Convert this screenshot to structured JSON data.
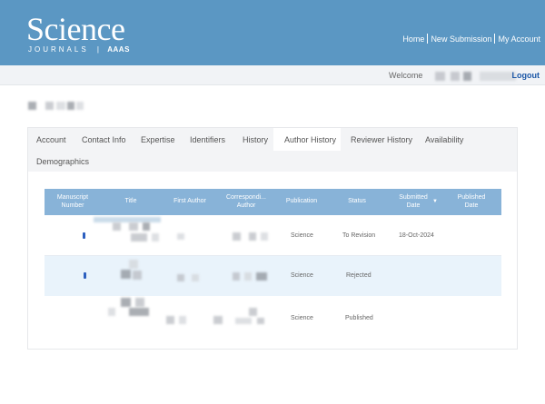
{
  "header": {
    "logo_title": "Science",
    "logo_subtitle": "JOURNALS",
    "logo_org": "AAAS",
    "nav": [
      {
        "label": "Home"
      },
      {
        "label": "New Submission"
      },
      {
        "label": "My Account"
      }
    ]
  },
  "welcome_bar": {
    "welcome_label": "Welcome",
    "logout_label": "Logout"
  },
  "tabs": [
    {
      "label": "Account"
    },
    {
      "label": "Contact Info"
    },
    {
      "label": "Expertise"
    },
    {
      "label": "Identifiers"
    },
    {
      "label": "History"
    },
    {
      "label": "Author History",
      "active": true
    },
    {
      "label": "Reviewer History"
    },
    {
      "label": "Availability"
    },
    {
      "label": "Demographics"
    }
  ],
  "table": {
    "columns": [
      "Manuscript Number",
      "Title",
      "First Author",
      "Correspondi... Author",
      "Publication",
      "Status",
      "Submitted Date",
      "Published Date"
    ],
    "rows": [
      {
        "publication": "Science",
        "status": "To Revision",
        "submitted": "18-Oct-2024",
        "published": ""
      },
      {
        "publication": "Science",
        "status": "Rejected",
        "submitted": "",
        "published": ""
      },
      {
        "publication": "Science",
        "status": "Published",
        "submitted": "",
        "published": ""
      }
    ]
  },
  "colors": {
    "header_bg": "#5b97c3",
    "table_header_bg": "#88b3d8",
    "link": "#1a56a6"
  },
  "icons": {
    "sort": "sort-down-icon"
  }
}
